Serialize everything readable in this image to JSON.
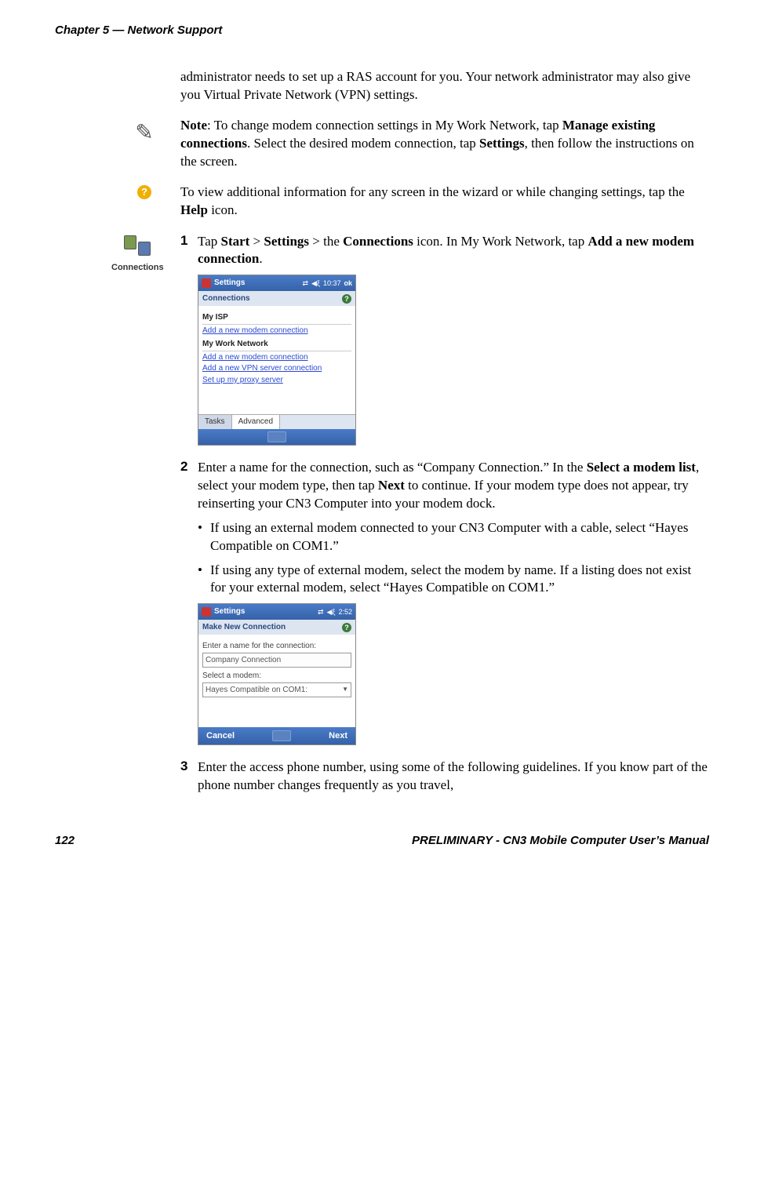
{
  "header": "Chapter 5 — Network Support",
  "intro": "administrator needs to set up a RAS account for you. Your network administrator may also give you Virtual Private Network (VPN) settings.",
  "note_prefix": "Note",
  "note_text1": ": To change modem connection settings in My Work Network, tap ",
  "note_bold1": "Manage existing connections",
  "note_text2": ". Select the desired modem connection, tap ",
  "note_bold2": "Settings",
  "note_text3": ", then follow the instructions on the screen.",
  "help_text1": "To view additional information for any screen in the wizard or while changing settings, tap the ",
  "help_bold": "Help",
  "help_text2": " icon.",
  "conn_label": "Connections",
  "step1": {
    "num": "1",
    "t1": "Tap ",
    "b1": "Start",
    "t2": " > ",
    "b2": "Settings",
    "t3": " > the ",
    "b3": "Connections",
    "t4": " icon. In My Work Network, tap ",
    "b4": "Add a new modem connection",
    "t5": "."
  },
  "ss1": {
    "title": "Settings",
    "time": "10:37",
    "ok": "ok",
    "sub": "Connections",
    "sec1": "My ISP",
    "link1": "Add a new modem connection",
    "sec2": "My Work Network",
    "link2": "Add a new modem connection",
    "link3": "Add a new VPN server connection",
    "link4": "Set up my proxy server",
    "tab1": "Tasks",
    "tab2": "Advanced"
  },
  "step2": {
    "num": "2",
    "t1": "Enter a name for the connection, such as “Company Connection.” In the ",
    "b1": "Select a modem list",
    "t2": ", select your modem type, then tap ",
    "b2": "Next",
    "t3": " to continue. If your modem type does not appear, try reinserting your CN3 Computer into your modem dock.",
    "bullet1": "If using an external modem connected to your CN3 Computer with a cable, select “Hayes Compatible on COM1.”",
    "bullet2": "If using any type of external modem, select the modem by name. If a listing does not exist for your external modem, select “Hayes Compatible on COM1.”"
  },
  "ss2": {
    "title": "Settings",
    "time": "2:52",
    "sub": "Make New Connection",
    "label1": "Enter a name for the connection:",
    "value1": "Company Connection",
    "label2": "Select a modem:",
    "value2": "Hayes Compatible on COM1:",
    "cancel": "Cancel",
    "next": "Next"
  },
  "step3": {
    "num": "3",
    "text": "Enter the access phone number, using some of the following guidelines. If you know part of the phone number changes frequently as you travel,"
  },
  "footer": {
    "page": "122",
    "title": "PRELIMINARY - CN3 Mobile Computer User’s Manual"
  }
}
